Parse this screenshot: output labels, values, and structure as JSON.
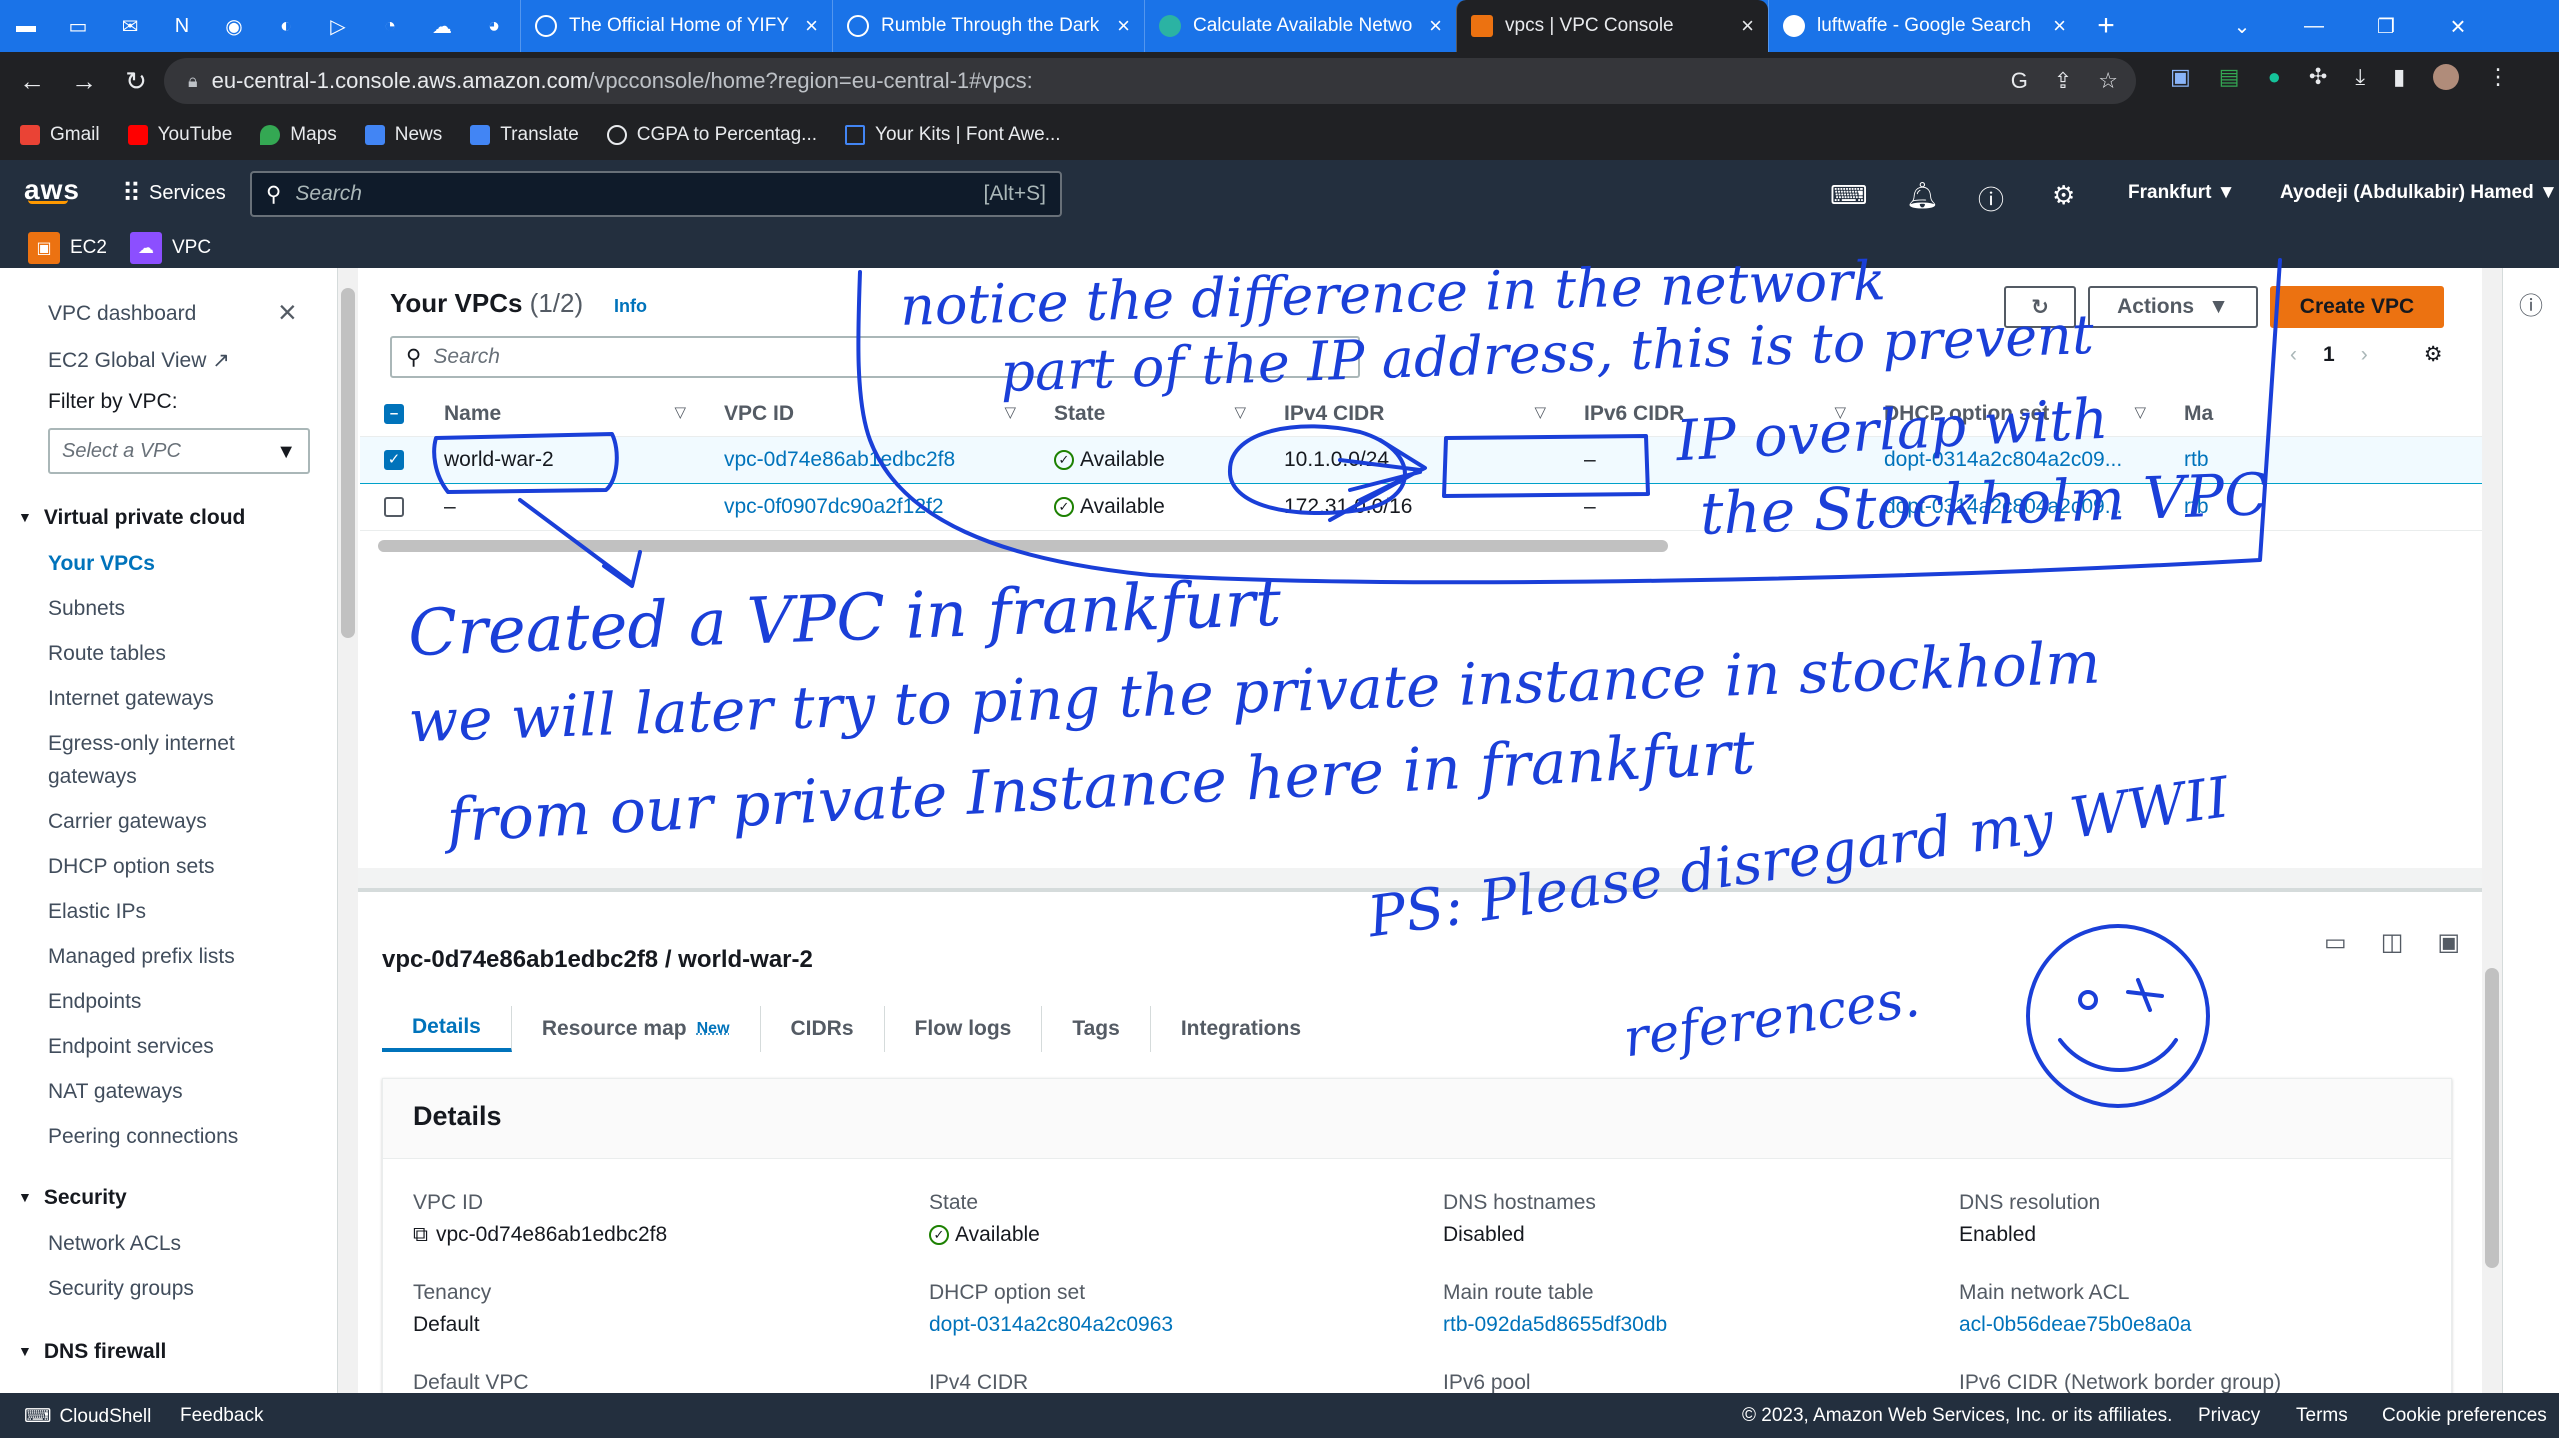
{
  "browser": {
    "tabs": [
      {
        "title": "The Official Home of YIFY",
        "active": false
      },
      {
        "title": "Rumble Through the Dark",
        "active": false
      },
      {
        "title": "Calculate Available Netwo",
        "active": false
      },
      {
        "title": "vpcs | VPC Console",
        "active": true
      },
      {
        "title": "luftwaffe - Google Search",
        "active": false
      }
    ],
    "url_host": "eu-central-1.console.aws.amazon.com",
    "url_path": "/vpcconsole/home?region=eu-central-1#vpcs:",
    "bookmarks": [
      "Gmail",
      "YouTube",
      "Maps",
      "News",
      "Translate",
      "CGPA to Percentag...",
      "Your Kits | Font Awe..."
    ]
  },
  "aws": {
    "logo": "aws",
    "services_label": "Services",
    "search_placeholder": "Search",
    "search_shortcut": "[Alt+S]",
    "region": "Frankfurt",
    "account": "Ayodeji (Abdulkabir) Hamed",
    "favorites": [
      "EC2",
      "VPC"
    ]
  },
  "sidebar": {
    "dashboard": "VPC dashboard",
    "global_view": "EC2 Global View",
    "filter_label": "Filter by VPC:",
    "filter_placeholder": "Select a VPC",
    "section_vpc": "Virtual private cloud",
    "items": [
      "Your VPCs",
      "Subnets",
      "Route tables",
      "Internet gateways",
      "Egress-only internet",
      "gateways",
      "Carrier gateways",
      "DHCP option sets",
      "Elastic IPs",
      "Managed prefix lists",
      "Endpoints",
      "Endpoint services",
      "NAT gateways",
      "Peering connections"
    ],
    "section_security": "Security",
    "security_items": [
      "Network ACLs",
      "Security groups"
    ],
    "section_dns": "DNS firewall"
  },
  "vpc_list": {
    "title": "Your VPCs",
    "count": "(1/2)",
    "info": "Info",
    "actions_label": "Actions",
    "create_label": "Create VPC",
    "search_placeholder": "Search",
    "page": "1",
    "columns": [
      "Name",
      "VPC ID",
      "State",
      "IPv4 CIDR",
      "IPv6 CIDR",
      "DHCP option set",
      "Ma"
    ],
    "rows": [
      {
        "name": "world-war-2",
        "vpc_id": "vpc-0d74e86ab1edbc2f8",
        "state": "Available",
        "ipv4": "10.1.0.0/24",
        "ipv6": "–",
        "dhcp": "dopt-0314a2c804a2c09...",
        "main": "rtb",
        "selected": true
      },
      {
        "name": "–",
        "vpc_id": "vpc-0f0907dc90a2f12f2",
        "state": "Available",
        "ipv4": "172.31.0.0/16",
        "ipv6": "–",
        "dhcp": "dopt-0314a2c804a2c09...",
        "main": "rtb",
        "selected": false
      }
    ]
  },
  "details": {
    "heading": "vpc-0d74e86ab1edbc2f8 / world-war-2",
    "tabs": [
      "Details",
      "Resource map",
      "CIDRs",
      "Flow logs",
      "Tags",
      "Integrations"
    ],
    "new_badge": "New",
    "card_title": "Details",
    "fields": {
      "vpc_id": {
        "label": "VPC ID",
        "value": "vpc-0d74e86ab1edbc2f8"
      },
      "state": {
        "label": "State",
        "value": "Available"
      },
      "dns_hostnames": {
        "label": "DNS hostnames",
        "value": "Disabled"
      },
      "dns_resolution": {
        "label": "DNS resolution",
        "value": "Enabled"
      },
      "tenancy": {
        "label": "Tenancy",
        "value": "Default"
      },
      "dhcp": {
        "label": "DHCP option set",
        "value": "dopt-0314a2c804a2c0963"
      },
      "main_rt": {
        "label": "Main route table",
        "value": "rtb-092da5d8655df30db"
      },
      "main_acl": {
        "label": "Main network ACL",
        "value": "acl-0b56deae75b0e8a0a"
      },
      "default_vpc": {
        "label": "Default VPC"
      },
      "ipv4_cidr": {
        "label": "IPv4 CIDR"
      },
      "ipv6_pool": {
        "label": "IPv6 pool"
      },
      "ipv6_cidr_nbg": {
        "label": "IPv6 CIDR (Network border group)"
      }
    }
  },
  "footer": {
    "cloudshell": "CloudShell",
    "feedback": "Feedback",
    "copyright": "© 2023, Amazon Web Services, Inc. or its affiliates.",
    "privacy": "Privacy",
    "terms": "Terms",
    "cookies": "Cookie preferences"
  },
  "annotations": {
    "note1_line1": "notice the difference in the network",
    "note1_line2": "part of the IP address, this is to prevent",
    "note1_line3": "IP overlap with",
    "note1_line4": "the Stockholm VPC",
    "note2_line1": "Created a VPC in frankfurt",
    "note2_line2": "we will later try to ping the private instance in stockholm",
    "note2_line3": "from our private Instance here in frankfurt",
    "note3_line1": "PS: Please disregard my WWII",
    "note3_line2": "references."
  },
  "colors": {
    "ink": "#1a3fd8",
    "aws_dark": "#232f3e",
    "accent": "#ec7211",
    "link": "#0073bb",
    "available": "#1d8102"
  }
}
